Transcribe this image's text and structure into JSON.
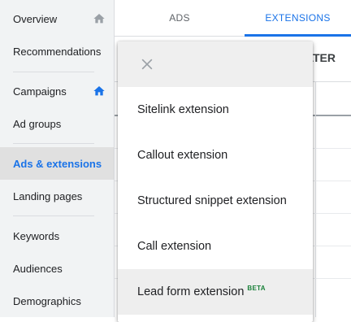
{
  "sidebar": {
    "items": [
      {
        "label": "Overview",
        "icon": "home-icon"
      },
      {
        "label": "Recommendations"
      },
      {
        "label": "Campaigns",
        "icon": "home-icon"
      },
      {
        "label": "Ad groups"
      },
      {
        "label": "Ads & extensions",
        "active": true
      },
      {
        "label": "Landing pages"
      },
      {
        "label": "Keywords"
      },
      {
        "label": "Audiences"
      },
      {
        "label": "Demographics"
      }
    ]
  },
  "tabs": [
    {
      "label": "ADS"
    },
    {
      "label": "EXTENSIONS",
      "active": true
    }
  ],
  "toolbar": {
    "filter_partial": "FILTER"
  },
  "dropdown": {
    "items": [
      {
        "label": "Sitelink extension"
      },
      {
        "label": "Callout extension"
      },
      {
        "label": "Structured snippet extension"
      },
      {
        "label": "Call extension"
      },
      {
        "label": "Lead form extension",
        "badge": "BETA"
      }
    ]
  },
  "colors": {
    "accent": "#1a73e8",
    "beta": "#188038",
    "sidebar_bg": "#f1f3f4",
    "active_bg": "#e0e0e0"
  }
}
